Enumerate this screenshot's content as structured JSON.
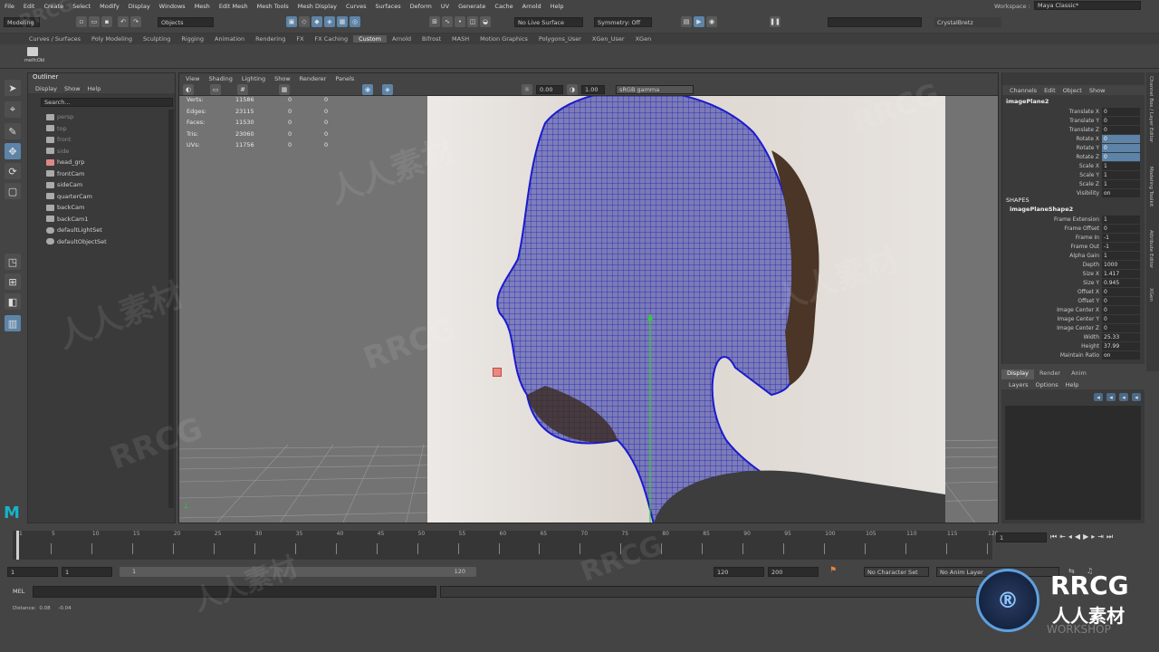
{
  "menubar": [
    "File",
    "Edit",
    "Create",
    "Select",
    "Modify",
    "Display",
    "Windows",
    "Mesh",
    "Edit Mesh",
    "Mesh Tools",
    "Mesh Display",
    "Curves",
    "Surfaces",
    "Deform",
    "UV",
    "Generate",
    "Cache",
    "Arnold",
    "Help"
  ],
  "status": {
    "mode": "Modeling",
    "selection_mode": "Objects",
    "live_surface": "No Live Surface",
    "symmetry": "Symmetry: Off",
    "user": "CrystalBretz",
    "workspace_label": "Workspace :",
    "workspace": "Maya Classic*"
  },
  "shelf_tabs": [
    "Curves / Surfaces",
    "Poly Modeling",
    "Sculpting",
    "Rigging",
    "Animation",
    "Rendering",
    "FX",
    "FX Caching",
    "Custom",
    "Arnold",
    "Bifrost",
    "MASH",
    "Motion Graphics",
    "Polygons_User",
    "XGen_User",
    "XGen"
  ],
  "shelf_active": "Custom",
  "shelf_item": "melfcObl",
  "outliner": {
    "title": "Outliner",
    "menu": [
      "Display",
      "Show",
      "Help"
    ],
    "search_placeholder": "Search...",
    "items": [
      {
        "label": "persp",
        "dim": true
      },
      {
        "label": "top",
        "dim": true
      },
      {
        "label": "front",
        "dim": true
      },
      {
        "label": "side",
        "dim": true
      },
      {
        "label": "head_grp",
        "dim": false
      },
      {
        "label": "frontCam",
        "dim": false
      },
      {
        "label": "sideCam",
        "dim": false
      },
      {
        "label": "quarterCam",
        "dim": false
      },
      {
        "label": "backCam",
        "dim": false
      },
      {
        "label": "backCam1",
        "dim": false
      },
      {
        "label": "defaultLightSet",
        "dim": false
      },
      {
        "label": "defaultObjectSet",
        "dim": false
      }
    ]
  },
  "viewport": {
    "menu": [
      "View",
      "Shading",
      "Lighting",
      "Show",
      "Renderer",
      "Panels"
    ],
    "field1": "0.00",
    "field2": "1.00",
    "colorspace": "sRGB gamma",
    "hud": [
      {
        "label": "Verts:",
        "a": "11586",
        "b": "0",
        "c": "0"
      },
      {
        "label": "Edges:",
        "a": "23115",
        "b": "0",
        "c": "0"
      },
      {
        "label": "Faces:",
        "a": "11530",
        "b": "0",
        "c": "0"
      },
      {
        "label": "Tris:",
        "a": "23060",
        "b": "0",
        "c": "0"
      },
      {
        "label": "UVs:",
        "a": "11756",
        "b": "0",
        "c": "0"
      }
    ]
  },
  "channelbox": {
    "menu": [
      "Channels",
      "Edit",
      "Object",
      "Show"
    ],
    "object": "imagePlane2",
    "channels": [
      {
        "l": "Translate X",
        "v": "0",
        "h": false
      },
      {
        "l": "Translate Y",
        "v": "0",
        "h": false
      },
      {
        "l": "Translate Z",
        "v": "0",
        "h": false
      },
      {
        "l": "Rotate X",
        "v": "0",
        "h": true
      },
      {
        "l": "Rotate Y",
        "v": "0",
        "h": true
      },
      {
        "l": "Rotate Z",
        "v": "0",
        "h": true
      },
      {
        "l": "Scale X",
        "v": "1",
        "h": false
      },
      {
        "l": "Scale Y",
        "v": "1",
        "h": false
      },
      {
        "l": "Scale Z",
        "v": "1",
        "h": false
      },
      {
        "l": "Visibility",
        "v": "on",
        "h": false
      }
    ],
    "shapes_label": "SHAPES",
    "shape": "imagePlaneShape2",
    "shape_channels": [
      {
        "l": "Frame Extension",
        "v": "1"
      },
      {
        "l": "Frame Offset",
        "v": "0"
      },
      {
        "l": "Frame In",
        "v": "-1"
      },
      {
        "l": "Frame Out",
        "v": "-1"
      },
      {
        "l": "Alpha Gain",
        "v": "1"
      },
      {
        "l": "Depth",
        "v": "1000"
      },
      {
        "l": "Size X",
        "v": "1.417"
      },
      {
        "l": "Size Y",
        "v": "0.945"
      },
      {
        "l": "Offset X",
        "v": "0"
      },
      {
        "l": "Offset Y",
        "v": "0"
      },
      {
        "l": "Image Center X",
        "v": "0"
      },
      {
        "l": "Image Center Y",
        "v": "0"
      },
      {
        "l": "Image Center Z",
        "v": "0"
      },
      {
        "l": "Width",
        "v": "25.33"
      },
      {
        "l": "Height",
        "v": "37.99"
      },
      {
        "l": "Maintain Ratio",
        "v": "on"
      }
    ]
  },
  "layers": {
    "tabs": [
      "Display",
      "Render",
      "Anim"
    ],
    "menu": [
      "Layers",
      "Options",
      "Help"
    ]
  },
  "side_tabs": [
    "Channel Box / Layer Editor",
    "Modeling Toolkit",
    "Attribute Editor",
    "XGen"
  ],
  "timeslider": {
    "ticks": [
      "1",
      "5",
      "10",
      "15",
      "20",
      "25",
      "30",
      "35",
      "40",
      "45",
      "50",
      "55",
      "60",
      "65",
      "70",
      "75",
      "80",
      "85",
      "90",
      "95",
      "100",
      "105",
      "110",
      "115",
      "120"
    ],
    "current": "1"
  },
  "range": {
    "start": "1",
    "start2": "1",
    "inner_start": "1",
    "inner_end": "120",
    "end": "120",
    "end2": "200",
    "character": "No Character Set",
    "anim_layer": "No Anim Layer"
  },
  "cmd": {
    "label": "MEL"
  },
  "help": {
    "text": "Distance:  0.08     -0.04"
  },
  "watermarks": {
    "brand": "RRCG",
    "cn": "人人素材",
    "workshop": "WORKSHOP"
  }
}
